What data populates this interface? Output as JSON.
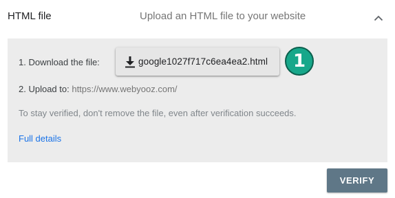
{
  "method": {
    "title": "HTML file",
    "subtitle": "Upload an HTML file to your website",
    "collapse_icon": "chevron-up-icon"
  },
  "steps": {
    "download_label": "1. Download the file:",
    "file_name": "google1027f717c6ea4ea2.html",
    "download_icon": "download-icon",
    "badge_number": "1",
    "badge_color": "#17a78a",
    "upload_prefix": "2. Upload to:",
    "upload_url": "https://www.webyooz.com/"
  },
  "note": "To stay verified, don't remove the file, even after verification succeeds.",
  "links": {
    "full_details": "Full details"
  },
  "actions": {
    "verify_label": "VERIFY",
    "verify_color": "#5f7787"
  },
  "colors": {
    "panel_bg": "#ececec",
    "link": "#1a73e8"
  }
}
